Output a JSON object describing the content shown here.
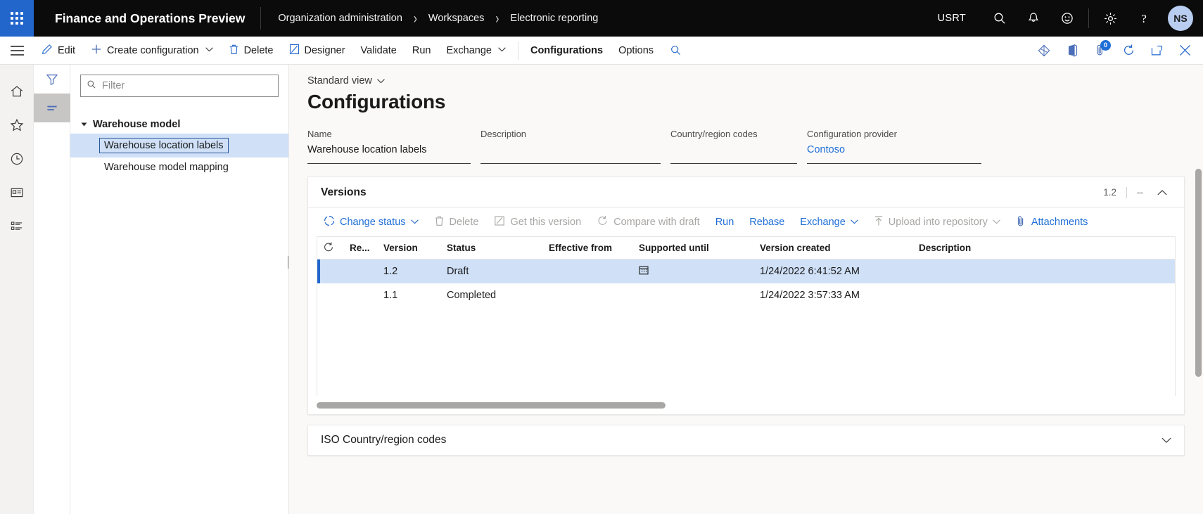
{
  "topbar": {
    "app_title": "Finance and Operations Preview",
    "breadcrumb": [
      "Organization administration",
      "Workspaces",
      "Electronic reporting"
    ],
    "breadcrumb_sep": "›",
    "company": "USRT",
    "avatar_initials": "NS",
    "icons": [
      "search-icon",
      "notifications-bell-icon",
      "feedback-smiley-icon",
      "settings-gear-icon",
      "help-question-icon"
    ],
    "accent_color": "#2266cc"
  },
  "commandbar": {
    "buttons": [
      {
        "label": "Edit",
        "icon": "pencil-icon",
        "strong": false
      },
      {
        "label": "Create configuration",
        "icon": "plus-icon",
        "caret": true,
        "strong": false
      },
      {
        "label": "Delete",
        "icon": "trash-icon",
        "strong": false
      },
      {
        "label": "Designer",
        "icon": "designer-icon",
        "strong": false
      },
      {
        "label": "Validate",
        "icon": "",
        "strong": false
      },
      {
        "label": "Run",
        "icon": "",
        "strong": false
      },
      {
        "label": "Exchange",
        "icon": "",
        "caret": true,
        "strong": false
      }
    ],
    "tabs": [
      {
        "label": "Configurations",
        "strong": true
      },
      {
        "label": "Options",
        "strong": false
      }
    ],
    "search_icon": "search-icon",
    "right_icons": [
      "personalize-diamond-icon",
      "office-app-icon",
      "attachments-icon",
      "refresh-icon",
      "popout-icon",
      "close-icon"
    ],
    "attachment_count": "0",
    "chevron": "⌄"
  },
  "rail": {
    "icons": [
      "home-icon",
      "favorites-star-icon",
      "recent-clock-icon",
      "workspaces-icon",
      "modules-list-icon"
    ]
  },
  "toolstrip": {
    "icons": [
      {
        "name": "filter-funnel-icon",
        "active": false
      },
      {
        "name": "list-lines-icon",
        "active": true
      }
    ]
  },
  "treepane": {
    "filter_placeholder": "Filter",
    "filter_value": "",
    "filter_icon": "search-icon",
    "root": {
      "label": "Warehouse model",
      "expanded": true
    },
    "children": [
      {
        "label": "Warehouse location labels",
        "selected": true
      },
      {
        "label": "Warehouse model mapping",
        "selected": false
      }
    ]
  },
  "main": {
    "view_selector": "Standard view",
    "view_chevron": "⌄",
    "page_title": "Configurations",
    "fields": [
      {
        "label": "Name",
        "value": "Warehouse location labels",
        "link": false
      },
      {
        "label": "Description",
        "value": "",
        "link": false
      },
      {
        "label": "Country/region codes",
        "value": "",
        "link": false
      },
      {
        "label": "Configuration provider",
        "value": "Contoso",
        "link": true
      }
    ]
  },
  "versions": {
    "title": "Versions",
    "summary_version": "1.2",
    "summary_extra": "--",
    "collapse_icon": "chevron-up-icon",
    "toolbar": [
      {
        "label": "Change status",
        "icon": "status-circle-icon",
        "caret": true,
        "disabled": false
      },
      {
        "label": "Delete",
        "icon": "trash-icon",
        "caret": false,
        "disabled": true
      },
      {
        "label": "Get this version",
        "icon": "get-version-icon",
        "caret": false,
        "disabled": true
      },
      {
        "label": "Compare with draft",
        "icon": "compare-refresh-icon",
        "caret": false,
        "disabled": true
      },
      {
        "label": "Run",
        "icon": "",
        "caret": false,
        "disabled": false
      },
      {
        "label": "Rebase",
        "icon": "",
        "caret": false,
        "disabled": false
      },
      {
        "label": "Exchange",
        "icon": "",
        "caret": true,
        "disabled": false
      },
      {
        "label": "Upload into repository",
        "icon": "upload-arrow-icon",
        "caret": true,
        "disabled": true
      },
      {
        "label": "Attachments",
        "icon": "paperclip-icon",
        "caret": false,
        "disabled": false
      }
    ],
    "columns": [
      "Re...",
      "Version",
      "Status",
      "Effective from",
      "Supported until",
      "Version created",
      "Description"
    ],
    "refresh_icon": "grid-refresh-icon",
    "rows": [
      {
        "re": "",
        "version": "1.2",
        "status": "Draft",
        "effective_from": "",
        "supported_until": "",
        "supported_until_icon": "calendar-icon",
        "version_created": "1/24/2022 6:41:52 AM",
        "description": "",
        "selected": true
      },
      {
        "re": "",
        "version": "1.1",
        "status": "Completed",
        "effective_from": "",
        "supported_until": "",
        "supported_until_icon": "",
        "version_created": "1/24/2022 3:57:33 AM",
        "description": "",
        "selected": false
      }
    ]
  },
  "bottom_section": {
    "title": "ISO Country/region codes",
    "chevron": "⌄"
  }
}
